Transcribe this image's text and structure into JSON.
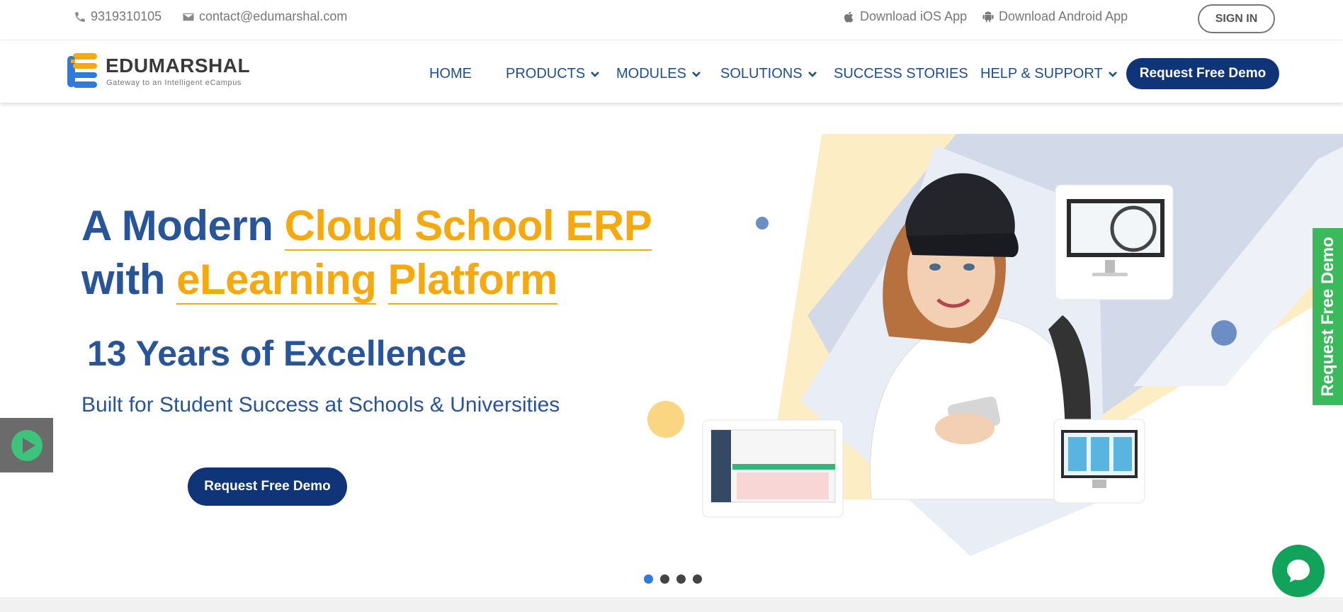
{
  "topbar": {
    "phone": "9319310105",
    "email": "contact@edumarshal.com",
    "ios_app": "Download iOS App",
    "android_app": "Download Android App",
    "sign_in": "SIGN IN"
  },
  "brand": {
    "name": "EDUMARSHAL",
    "tagline": "Gateway to an Intelligent eCampus"
  },
  "nav": {
    "items": [
      {
        "label": "HOME"
      },
      {
        "label": "PRODUCTS"
      },
      {
        "label": "MODULES"
      },
      {
        "label": "SOLUTIONS"
      },
      {
        "label": "SUCCESS STORIES"
      },
      {
        "label": "HELP & SUPPORT"
      }
    ],
    "demo_button": "Request Free Demo"
  },
  "hero": {
    "line1_plain": "A Modern ",
    "line1_highlight": "Cloud School ERP",
    "line2_plain": "with ",
    "line2_highlight_a": "eLearning",
    "line2_highlight_b": "Platform",
    "years": "13 Years of Excellence",
    "subtitle": "Built for Student Success at Schools & Universities",
    "demo_button": "Request Free Demo"
  },
  "side_tab": {
    "label": "Request Free Demo"
  },
  "slider": {
    "count": 4,
    "active": 1
  },
  "colors": {
    "primary_blue": "#285599",
    "accent_orange": "#f5a90f",
    "button_navy": "#0f3578",
    "green": "#3cb95b",
    "chat_green": "#11a35a",
    "dot_active": "#2e7be0"
  },
  "icons": [
    "phone-icon",
    "mail-icon",
    "apple-icon",
    "android-icon",
    "chevron-down-icon",
    "play-icon",
    "chat-icon"
  ]
}
